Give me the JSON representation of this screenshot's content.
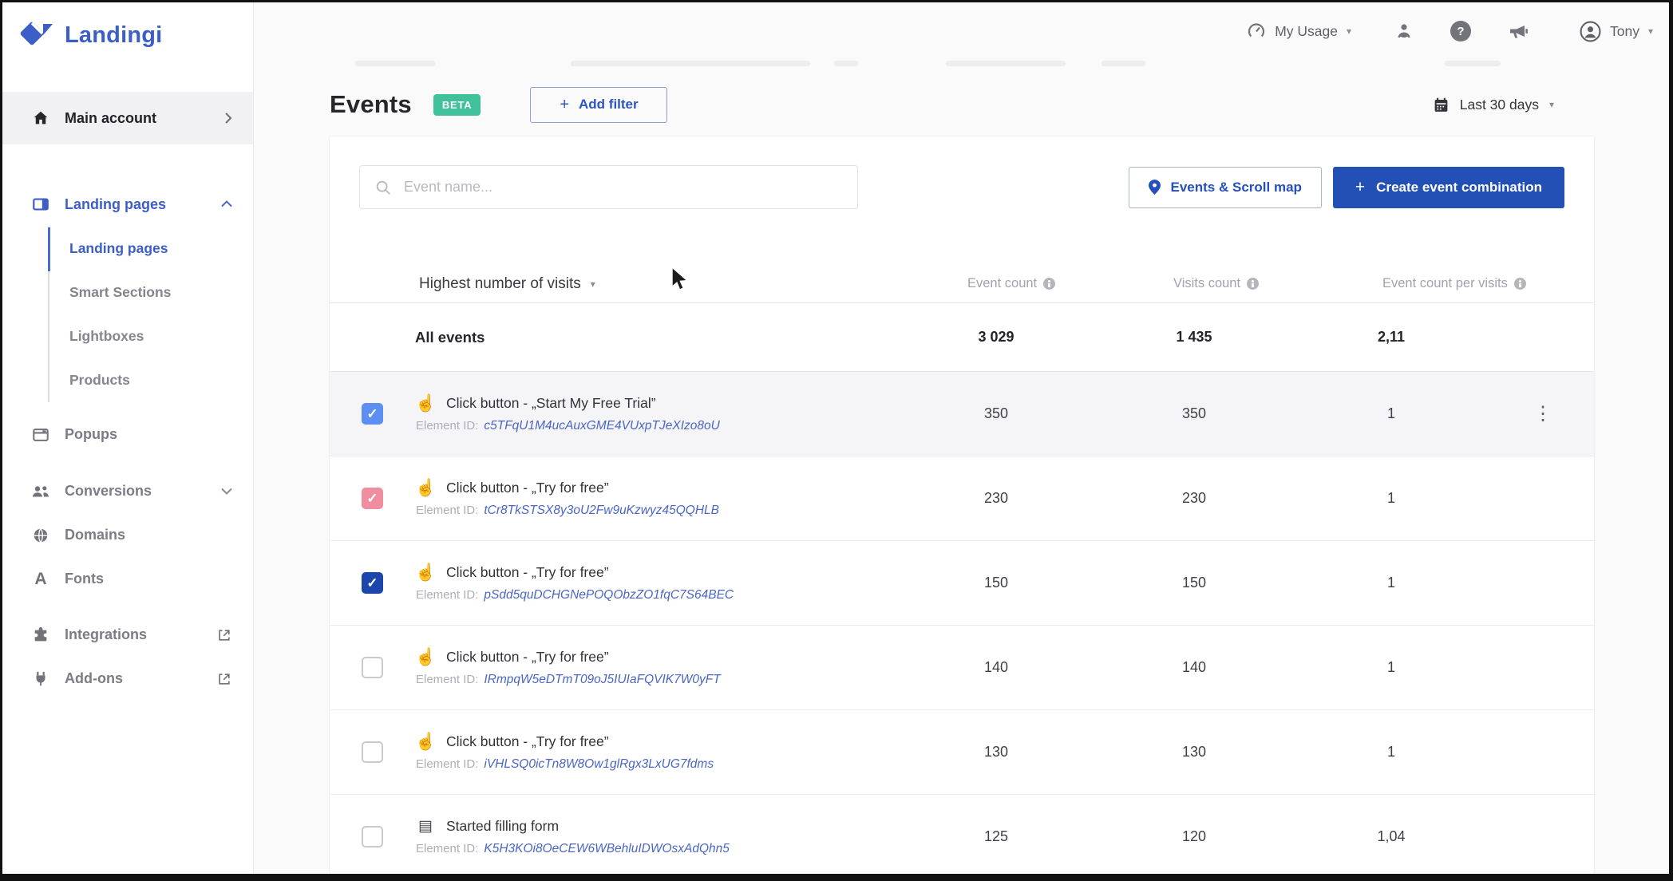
{
  "brand": {
    "name": "Landingi"
  },
  "topbar": {
    "usage_label": "My Usage",
    "user_name": "Tony"
  },
  "sidebar": {
    "main_account": "Main account",
    "landing_pages_group": "Landing pages",
    "submenu": [
      "Landing pages",
      "Smart Sections",
      "Lightboxes",
      "Products"
    ],
    "active_submenu_index": 0,
    "popups": "Popups",
    "conversions": "Conversions",
    "domains": "Domains",
    "fonts": "Fonts",
    "integrations": "Integrations",
    "addons": "Add-ons"
  },
  "page": {
    "title": "Events",
    "beta_badge": "BETA",
    "add_filter_label": "Add filter",
    "date_range": "Last 30 days"
  },
  "toolbar": {
    "search_placeholder": "Event name...",
    "scroll_map_label": "Events & Scroll map",
    "create_combination_label": "Create event combination"
  },
  "table": {
    "sort_label": "Highest number of visits",
    "columns": [
      "Event count",
      "Visits count",
      "Event count per visits"
    ],
    "element_id_label": "Element ID:",
    "all_events": {
      "label": "All events",
      "event_count": "3 029",
      "visits_count": "1 435",
      "per_visits": "2,11"
    },
    "rows": [
      {
        "icon": "click",
        "name": "Click button - „Start My Free Trial”",
        "element_id": "c5TFqU1M4ucAuxGME4VUxpTJeXIzo8oU",
        "event_count": "350",
        "visits_count": "350",
        "per_visits": "1",
        "checkbox_state": "checked",
        "checkbox_color": "lightblue",
        "highlighted": true,
        "has_menu": true
      },
      {
        "icon": "click",
        "name": "Click button - „Try for free”",
        "element_id": "tCr8TkSTSX8y3oU2Fw9uKzwyz45QQHLB",
        "event_count": "230",
        "visits_count": "230",
        "per_visits": "1",
        "checkbox_state": "checked",
        "checkbox_color": "pink",
        "highlighted": false,
        "has_menu": false
      },
      {
        "icon": "click",
        "name": "Click button - „Try for free”",
        "element_id": "pSdd5quDCHGNePOQObzZO1fqC7S64BEC",
        "event_count": "150",
        "visits_count": "150",
        "per_visits": "1",
        "checkbox_state": "checked",
        "checkbox_color": "darkblue",
        "highlighted": false,
        "has_menu": false
      },
      {
        "icon": "click",
        "name": "Click button - „Try for free”",
        "element_id": "IRmpqW5eDTmT09oJ5IUIaFQVIK7W0yFT",
        "event_count": "140",
        "visits_count": "140",
        "per_visits": "1",
        "checkbox_state": "unchecked",
        "checkbox_color": null,
        "highlighted": false,
        "has_menu": false
      },
      {
        "icon": "click",
        "name": "Click button - „Try for free”",
        "element_id": "iVHLSQ0icTn8W8Ow1glRgx3LxUG7fdms",
        "event_count": "130",
        "visits_count": "130",
        "per_visits": "1",
        "checkbox_state": "unchecked",
        "checkbox_color": null,
        "highlighted": false,
        "has_menu": false
      },
      {
        "icon": "form",
        "name": "Started filling form",
        "element_id": "K5H3KOi8OeCEW6WBehluIDWOsxAdQhn5",
        "event_count": "125",
        "visits_count": "120",
        "per_visits": "1,04",
        "checkbox_state": "unchecked",
        "checkbox_color": null,
        "highlighted": false,
        "has_menu": false
      }
    ]
  },
  "icons": {
    "plus": "+",
    "caret_down": "▾",
    "kebab": "⋮",
    "check": "✓",
    "click": "☝",
    "form": "▤",
    "question": "?",
    "fonts_glyph": "A"
  },
  "checkbox_colors": {
    "lightblue": "#5b90f2",
    "pink": "#f18da0",
    "darkblue": "#1b46ab"
  },
  "accent_colors": {
    "primary_blue": "#2350b4",
    "link_blue": "#4a66c4",
    "beta_green": "#40c19c"
  }
}
